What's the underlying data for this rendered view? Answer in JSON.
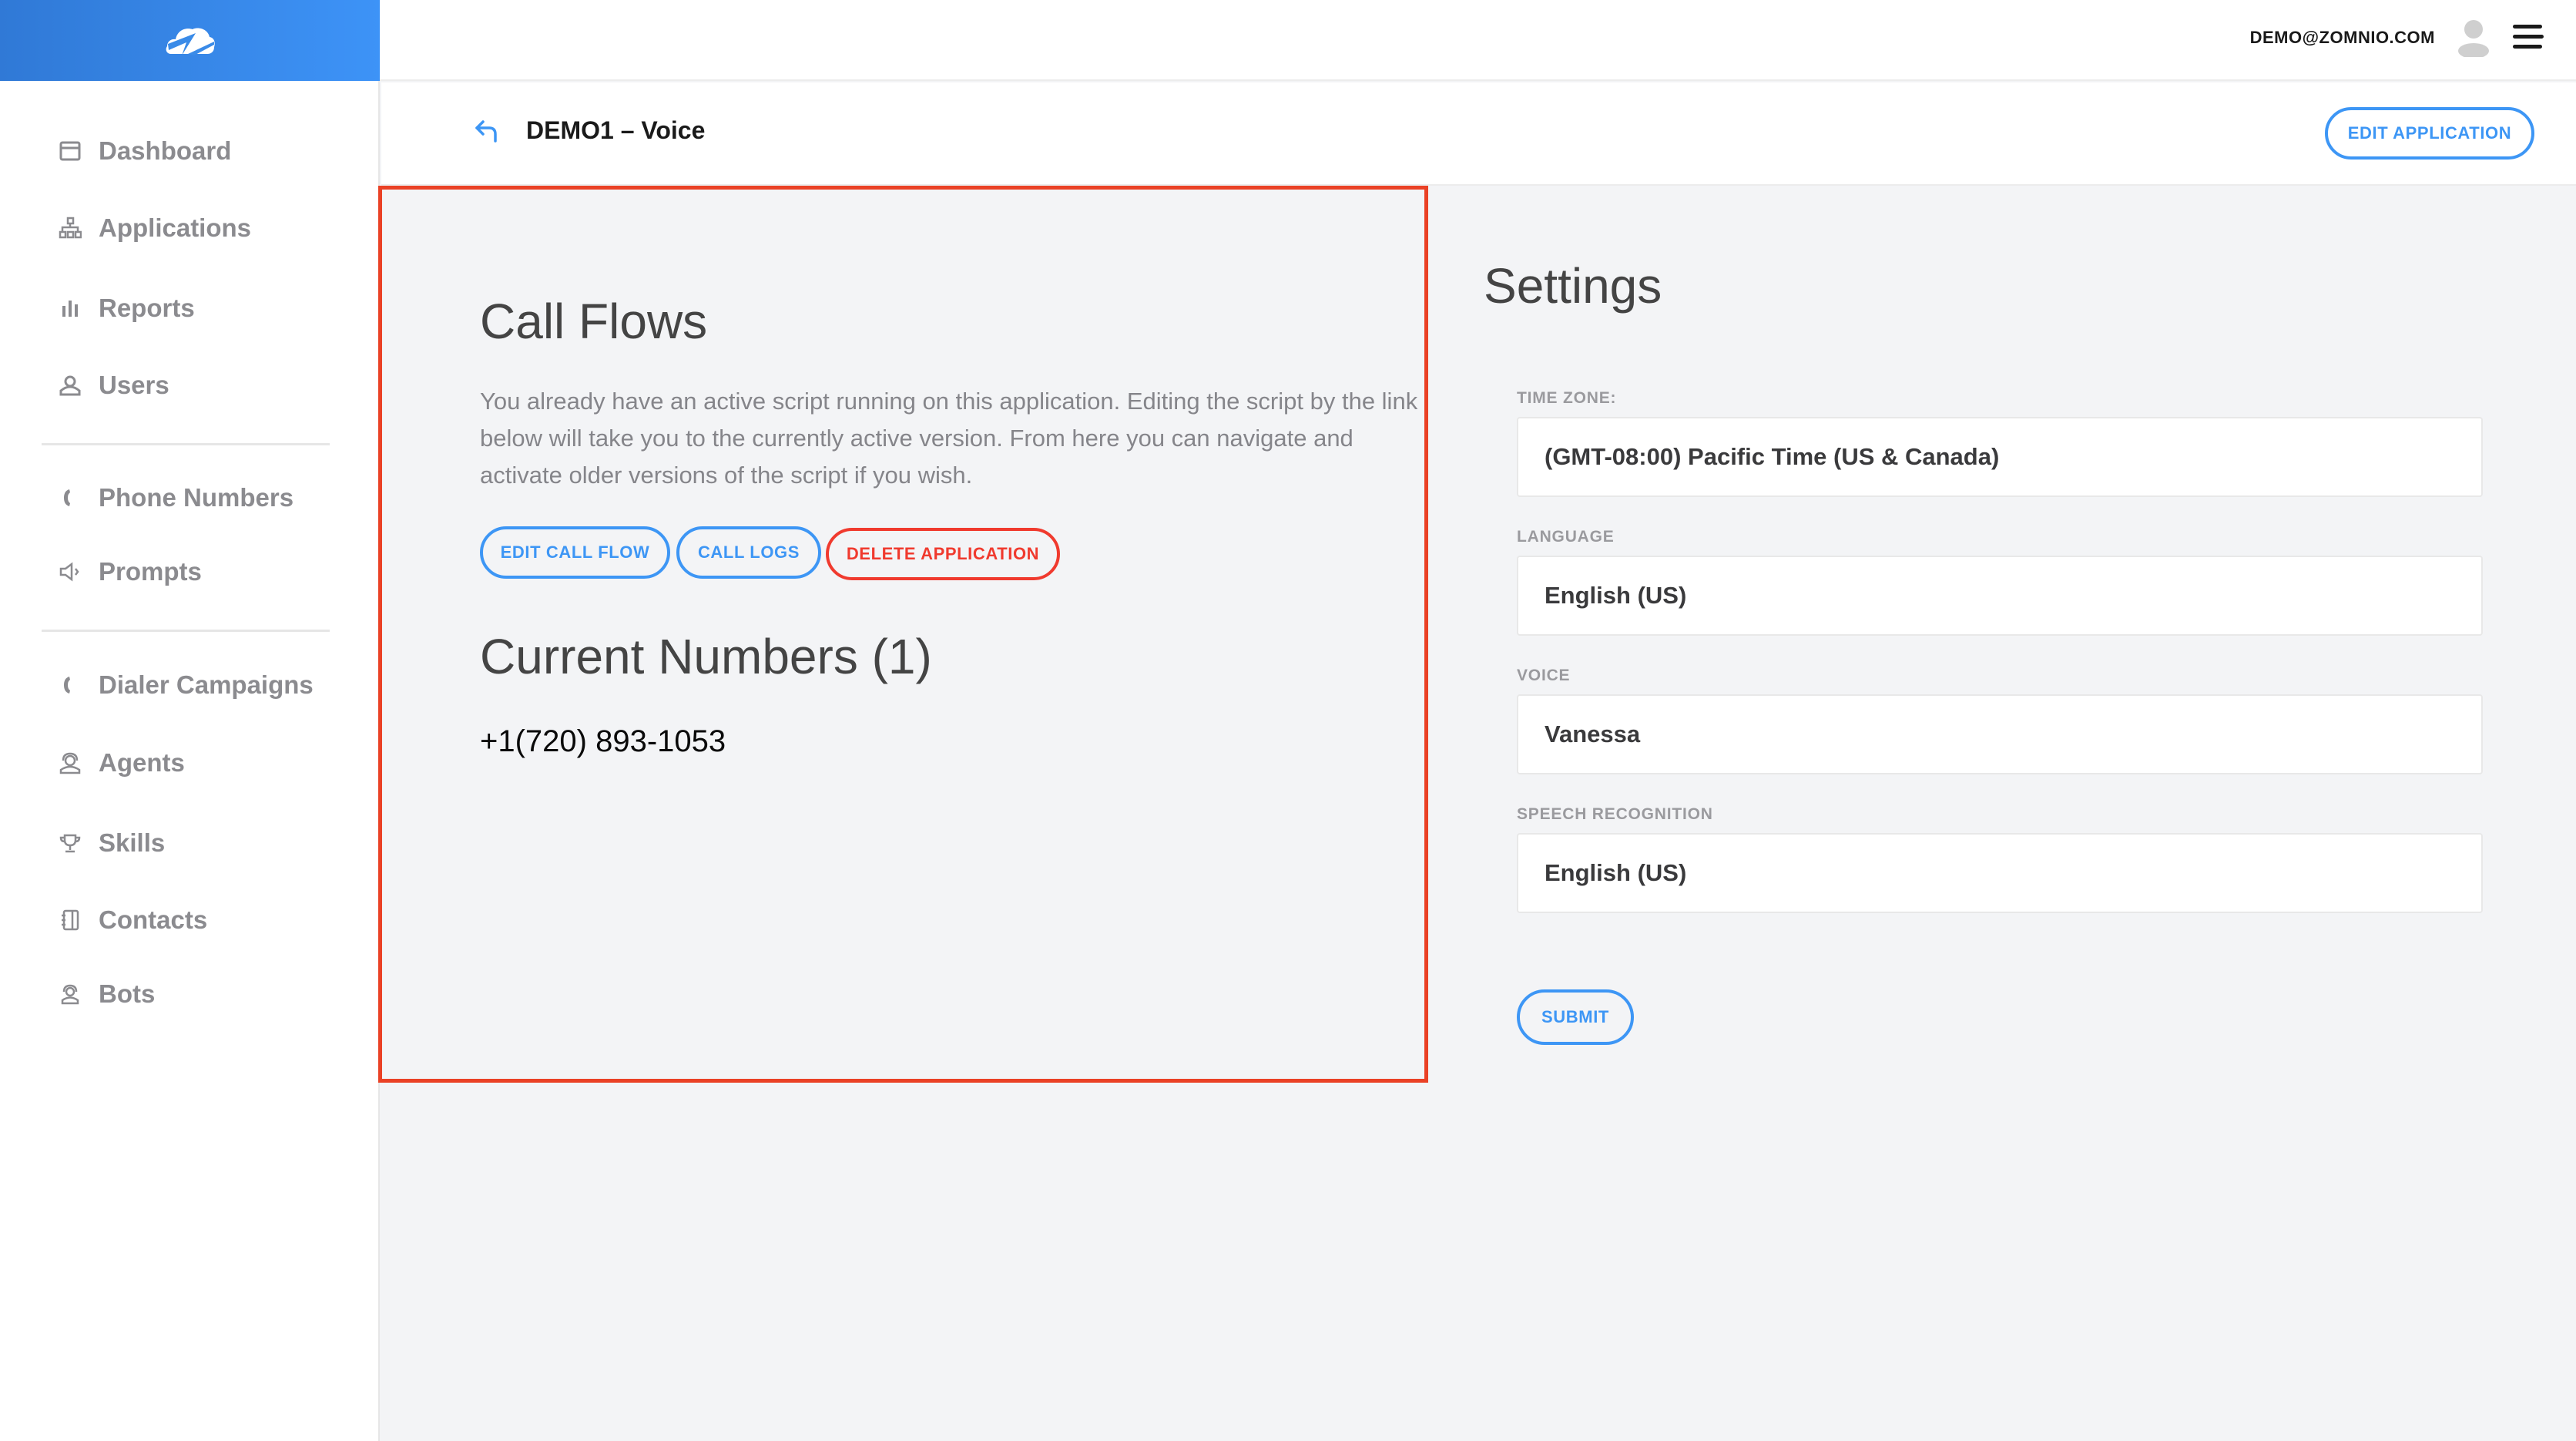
{
  "header": {
    "logo": "zomnio-cloud-logo",
    "user_email": "DEMO@ZOMNIO.COM",
    "avatar_icon": "user-avatar-icon",
    "menu_icon": "hamburger-menu-icon"
  },
  "sidebar": {
    "groups": [
      [
        {
          "label": "Dashboard",
          "icon": "dashboard-icon"
        },
        {
          "label": "Applications",
          "icon": "sitemap-icon"
        },
        {
          "label": "Reports",
          "icon": "bar-chart-icon"
        },
        {
          "label": "Users",
          "icon": "user-icon"
        }
      ],
      [
        {
          "label": "Phone Numbers",
          "icon": "phone-icon"
        },
        {
          "label": "Prompts",
          "icon": "megaphone-icon"
        }
      ],
      [
        {
          "label": "Dialer Campaigns",
          "icon": "phone-icon"
        },
        {
          "label": "Agents",
          "icon": "agent-headset-icon"
        },
        {
          "label": "Skills",
          "icon": "trophy-icon"
        },
        {
          "label": "Contacts",
          "icon": "address-book-icon"
        },
        {
          "label": "Bots",
          "icon": "bot-icon"
        }
      ]
    ]
  },
  "subheader": {
    "title": "DEMO1 – Voice",
    "edit_application_label": "EDIT APPLICATION"
  },
  "call_flows": {
    "title": "Call Flows",
    "description": "You already have an active script running on this application. Editing the script by the link below will take you to the currently active version. From here you can navigate and activate older versions of the script if you wish.",
    "buttons": {
      "edit_call_flow": "EDIT CALL FLOW",
      "call_logs": "CALL LOGS",
      "delete_application": "DELETE APPLICATION"
    }
  },
  "current_numbers": {
    "title": "Current Numbers (1)",
    "numbers": [
      "+1(720) 893-1053"
    ]
  },
  "settings": {
    "title": "Settings",
    "fields": [
      {
        "label": "TIME ZONE:",
        "value": "(GMT-08:00) Pacific Time (US & Canada)"
      },
      {
        "label": "LANGUAGE",
        "value": "English (US)"
      },
      {
        "label": "VOICE",
        "value": "Vanessa"
      },
      {
        "label": "SPEECH RECOGNITION",
        "value": "English (US)"
      }
    ],
    "submit_label": "SUBMIT"
  },
  "colors": {
    "brand_blue": "#3d93f7",
    "accent_blue": "#3d96f5",
    "danger_red": "#f03a2e",
    "highlight_red": "#ea4125"
  }
}
